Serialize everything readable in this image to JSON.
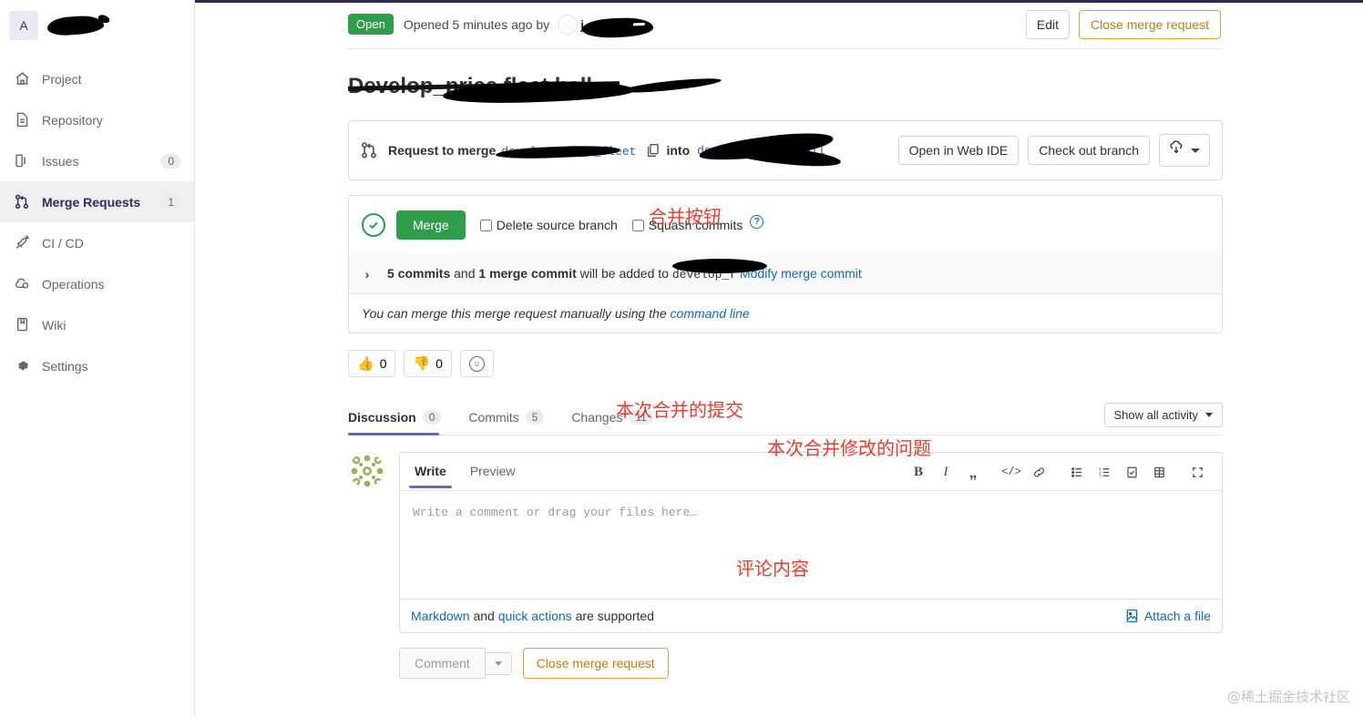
{
  "sidebar": {
    "project_initial": "A",
    "items": [
      {
        "label": "Project",
        "icon": "home-icon",
        "badge": ""
      },
      {
        "label": "Repository",
        "icon": "document-icon",
        "badge": ""
      },
      {
        "label": "Issues",
        "icon": "issues-icon",
        "badge": "0"
      },
      {
        "label": "Merge Requests",
        "icon": "merge-request-icon",
        "badge": "1"
      },
      {
        "label": "CI / CD",
        "icon": "rocket-icon",
        "badge": ""
      },
      {
        "label": "Operations",
        "icon": "operations-icon",
        "badge": ""
      },
      {
        "label": "Wiki",
        "icon": "book-icon",
        "badge": ""
      },
      {
        "label": "Settings",
        "icon": "gear-icon",
        "badge": ""
      }
    ]
  },
  "header": {
    "status_badge": "Open",
    "opened_text": "Opened 5 minutes ago by",
    "author_prefix": "j",
    "edit_label": "Edit",
    "close_label": "Close merge request"
  },
  "title": {
    "text": "Develop_price fleet ball"
  },
  "merge_ref": {
    "request_label": "Request to merge",
    "source_branch": "develop_price_fleet",
    "into_label": "into",
    "target_branch": "develop_fleet_ball",
    "copy_icon": "copy-icon",
    "open_web_ide": "Open in Web IDE",
    "check_out_branch": "Check out branch",
    "download_icon": "download-icon"
  },
  "merge_widget": {
    "status_icon": "check-circle-icon",
    "merge_button": "Merge",
    "delete_source_branch": "Delete source branch",
    "squash_commits": "Squash commits",
    "help_icon": "question-mark-icon",
    "commits_count_text": "5 commits",
    "and_text": "and",
    "merge_commit_text": "1 merge commit",
    "will_be_added": "will be added to",
    "target_branch_short": "develop_f",
    "modify_merge_commit": "Modify merge commit",
    "manual_prefix": "You can merge this merge request manually using the",
    "command_line": "command line"
  },
  "reactions": [
    {
      "icon": "thumbs-up-icon",
      "emoji": "👍",
      "count": "0"
    },
    {
      "icon": "thumbs-down-icon",
      "emoji": "👎",
      "count": "0"
    }
  ],
  "add_reaction_icon": "smiley-icon",
  "tabs": [
    {
      "label": "Discussion",
      "count": "0",
      "active": true
    },
    {
      "label": "Commits",
      "count": "5",
      "active": false
    },
    {
      "label": "Changes",
      "count": "11",
      "active": false
    }
  ],
  "show_activity": {
    "label": "Show all activity",
    "icon": "chevron-down-icon"
  },
  "editor": {
    "avatar_icon": "identicon-avatar",
    "write_tab": "Write",
    "preview_tab": "Preview",
    "placeholder": "Write a comment or drag your files here…",
    "value": "",
    "tools": [
      {
        "name": "bold-icon",
        "glyph": "B"
      },
      {
        "name": "italic-icon",
        "glyph": "I"
      },
      {
        "name": "quote-icon",
        "glyph": "”"
      },
      {
        "name": "code-icon",
        "glyph": "</>"
      },
      {
        "name": "link-icon",
        "glyph": "🔗"
      },
      {
        "name": "bullet-list-icon",
        "glyph": "≡"
      },
      {
        "name": "numbered-list-icon",
        "glyph": "≣"
      },
      {
        "name": "task-list-icon",
        "glyph": "☑"
      },
      {
        "name": "table-icon",
        "glyph": "▦"
      },
      {
        "name": "fullscreen-icon",
        "glyph": "⛶"
      }
    ],
    "footer": {
      "markdown_link": "Markdown",
      "and_text": "and",
      "quick_actions_link": "quick actions",
      "supported_text": "are supported",
      "attach_label": "Attach a file",
      "attach_icon": "image-file-icon"
    }
  },
  "form_actions": {
    "comment_label": "Comment",
    "dropdown_icon": "caret-down-icon",
    "close_mr_label": "Close merge request"
  },
  "annotations": [
    {
      "text": "合并按钮",
      "pos": "a1"
    },
    {
      "text": "本次合并的提交",
      "pos": "a2"
    },
    {
      "text": "本次合并修改的问题",
      "pos": "a3"
    },
    {
      "text": "评论内容",
      "pos": "a4"
    }
  ],
  "watermark": "@稀土掘金技术社区",
  "colors": {
    "open_green": "#2e9e4a",
    "merge_green": "#2e9e4a",
    "warning_orange": "#c17d10",
    "link_blue": "#1068bf",
    "active_purple": "#6666c4",
    "annotation_red": "#f0392b"
  }
}
